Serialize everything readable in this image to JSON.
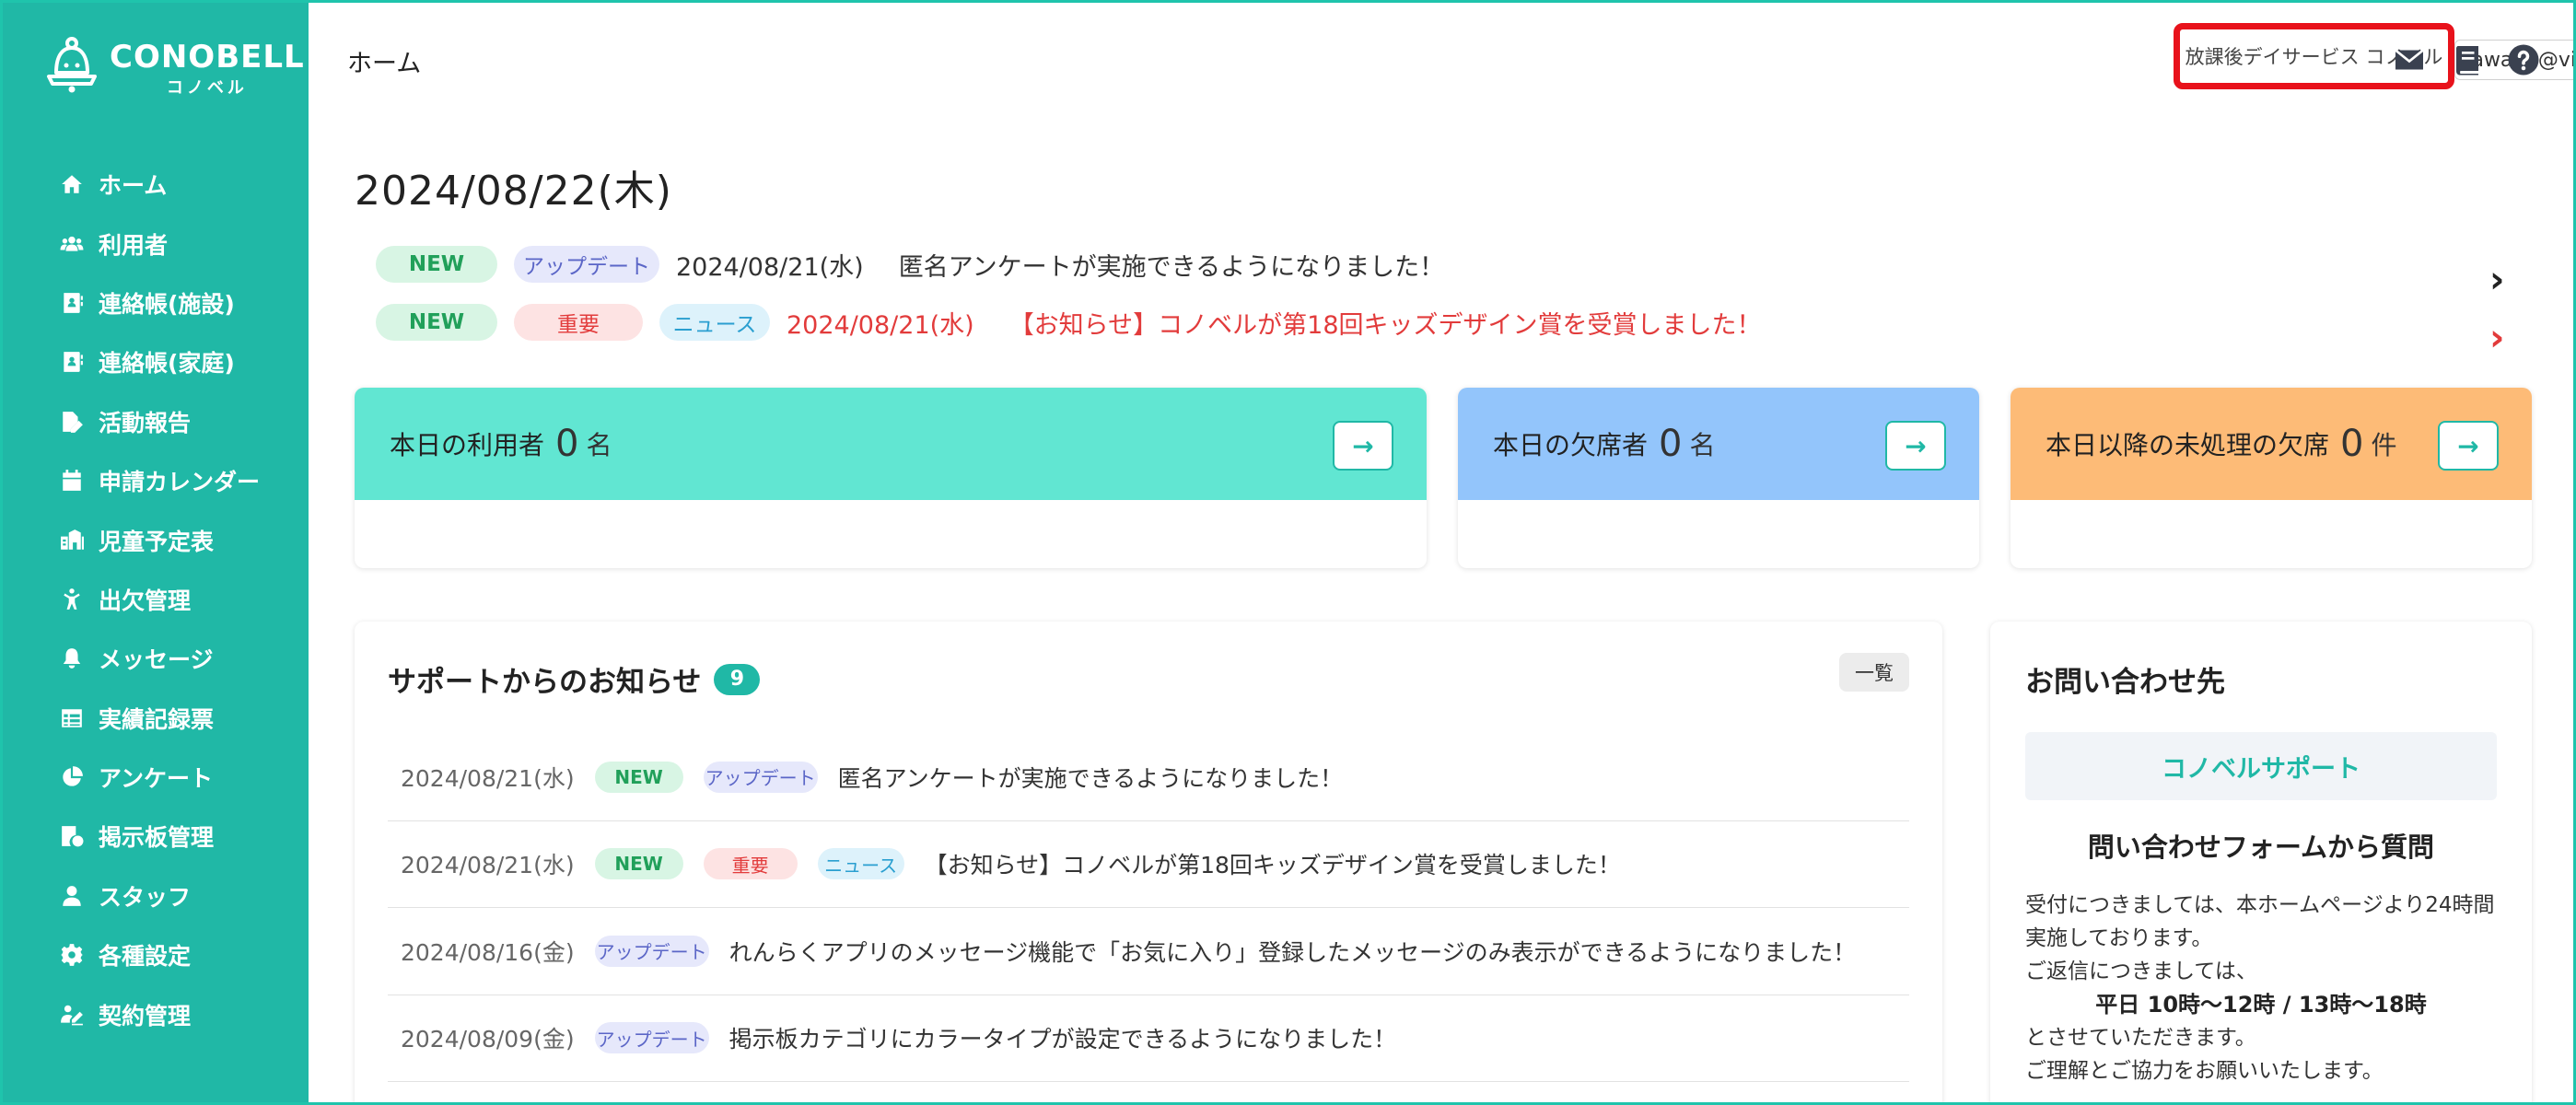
{
  "brand": {
    "name": "CONOBELL",
    "sub": "コノベル"
  },
  "sidebar": {
    "items": [
      {
        "label": "ホーム",
        "icon": "home-icon"
      },
      {
        "label": "利用者",
        "icon": "users-icon"
      },
      {
        "label": "連絡帳(施設)",
        "icon": "contact-book-icon"
      },
      {
        "label": "連絡帳(家庭)",
        "icon": "contact-book-icon"
      },
      {
        "label": "活動報告",
        "icon": "report-icon"
      },
      {
        "label": "申請カレンダー",
        "icon": "calendar-icon"
      },
      {
        "label": "児童予定表",
        "icon": "schedule-icon"
      },
      {
        "label": "出欠管理",
        "icon": "attendance-icon"
      },
      {
        "label": "メッセージ",
        "icon": "bell-icon"
      },
      {
        "label": "実績記録票",
        "icon": "table-icon"
      },
      {
        "label": "アンケート",
        "icon": "pie-chart-icon"
      },
      {
        "label": "掲示板管理",
        "icon": "board-icon"
      },
      {
        "label": "スタッフ",
        "icon": "staff-icon"
      },
      {
        "label": "各種設定",
        "icon": "gear-icon"
      },
      {
        "label": "契約管理",
        "icon": "contract-icon"
      }
    ]
  },
  "header": {
    "breadcrumb": "ホーム",
    "facility": "放課後デイサービス コノベル",
    "account": "sawada@vish.co.jp"
  },
  "main": {
    "date": "2024/08/22(木)",
    "news": [
      {
        "badges": [
          "NEW",
          "アップデート"
        ],
        "date": "2024/08/21(水)",
        "text": "匿名アンケートが実施できるようになりました！"
      },
      {
        "badges": [
          "NEW",
          "重要",
          "ニュース"
        ],
        "date": "2024/08/21(水)",
        "text": "【お知らせ】コノベルが第18回キッズデザイン賞を受賞しました！"
      }
    ],
    "cards": [
      {
        "label": "本日の利用者",
        "value": "0",
        "unit": "名",
        "color": "#61e6d2"
      },
      {
        "label": "本日の欠席者",
        "value": "0",
        "unit": "名",
        "color": "#93c5fb"
      },
      {
        "label": "本日以降の未処理の欠席",
        "value": "0",
        "unit": "件",
        "color": "#fdbb77"
      }
    ]
  },
  "notices": {
    "title": "サポートからのお知らせ",
    "count": "9",
    "list_button": "一覧",
    "rows": [
      {
        "date": "2024/08/21(水)",
        "badges": [
          "NEW",
          "アップデート"
        ],
        "text": "匿名アンケートが実施できるようになりました！"
      },
      {
        "date": "2024/08/21(水)",
        "badges": [
          "NEW",
          "重要",
          "ニュース"
        ],
        "text": "【お知らせ】コノベルが第18回キッズデザイン賞を受賞しました！"
      },
      {
        "date": "2024/08/16(金)",
        "badges": [
          "アップデート"
        ],
        "text": "れんらくアプリのメッセージ機能で「お気に入り」登録したメッセージのみ表示ができるようになりました！"
      },
      {
        "date": "2024/08/09(金)",
        "badges": [
          "アップデート"
        ],
        "text": "掲示板カテゴリにカラータイプが設定できるようになりました！"
      }
    ]
  },
  "contact": {
    "title": "お問い合わせ先",
    "support": "コノベルサポート",
    "form_title": "問い合わせフォームから質問",
    "line1": "受付につきましては、本ホームページより24時間実施しております。",
    "line2": "ご返信につきましては、",
    "hours": "平日 10時〜12時 / 13時〜18時",
    "line3": "とさせていただきます。",
    "line4": "ご理解とご協力をお願いいたします。"
  },
  "colors": {
    "primary": "#20b8a6",
    "highlight": "#e8121b"
  }
}
